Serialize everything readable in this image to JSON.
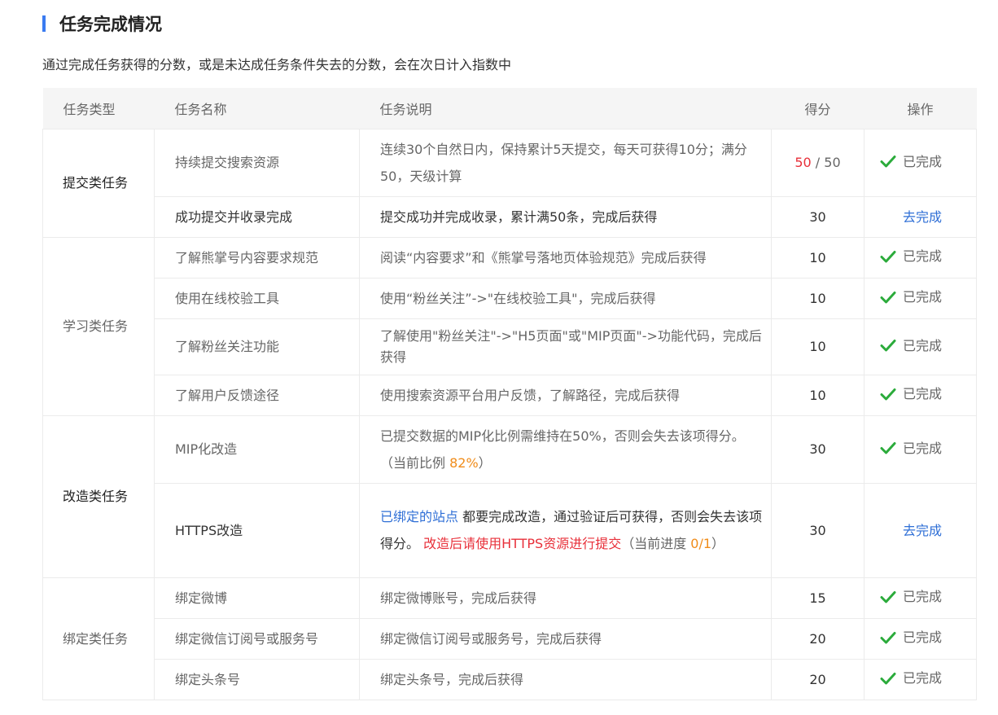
{
  "section": {
    "title": "任务完成情况",
    "description": "通过完成任务获得的分数，或是未达成任务条件失去的分数，会在次日计入指数中"
  },
  "table": {
    "headers": {
      "type": "任务类型",
      "name": "任务名称",
      "explanation": "任务说明",
      "score": "得分",
      "action": "操作"
    },
    "status": {
      "done": "已完成",
      "todo": "去完成"
    },
    "categories": {
      "submit": "提交类任务",
      "learn": "学习类任务",
      "modify": "改造类任务",
      "bind": "绑定类任务"
    },
    "rows": {
      "r1": {
        "name": "持续提交搜索资源",
        "explanation": "连续30个自然日内，保持累计5天提交，每天可获得10分；满分50，天级计算",
        "score": "50",
        "score_sep": " / ",
        "score_max": "50"
      },
      "r2": {
        "name": "成功提交并收录完成",
        "explanation": "提交成功并完成收录，累计满50条，完成后获得",
        "score": "30"
      },
      "r3": {
        "name": "了解熊掌号内容要求规范",
        "explanation": "阅读“内容要求”和《熊掌号落地页体验规范》完成后获得",
        "score": "10"
      },
      "r4": {
        "name": "使用在线校验工具",
        "explanation": "使用“粉丝关注”->\"在线校验工具\"，完成后获得",
        "score": "10"
      },
      "r5": {
        "name": "了解粉丝关注功能",
        "explanation": "了解使用\"粉丝关注\"->\"H5页面\"或\"MIP页面\"->功能代码，完成后获得",
        "score": "10"
      },
      "r6": {
        "name": "了解用户反馈途径",
        "explanation": "使用搜索资源平台用户反馈，了解路径，完成后获得",
        "score": "10"
      },
      "r7": {
        "name": "MIP化改造",
        "explanation_pre": "已提交数据的MIP化比例需维持在50%，否则会失去该项得分。 （当前比例 ",
        "explanation_ratio": "82%",
        "explanation_post": "）",
        "score": "30"
      },
      "r8": {
        "name": "HTTPS改造",
        "explanation_link": "已绑定的站点",
        "explanation_mid": " 都要完成改造，通过验证后可获得，否则会失去该项得分。 ",
        "explanation_warn": "改造后请使用HTTPS资源进行提交",
        "explanation_progress_pre": "（当前进度 ",
        "explanation_progress": "0/1",
        "explanation_progress_post": "）",
        "score": "30"
      },
      "r9": {
        "name": "绑定微博",
        "explanation": "绑定微博账号，完成后获得",
        "score": "15"
      },
      "r10": {
        "name": "绑定微信订阅号或服务号",
        "explanation": "绑定微信订阅号或服务号，完成后获得",
        "score": "20"
      },
      "r11": {
        "name": "绑定头条号",
        "explanation": "绑定头条号，完成后获得",
        "score": "20"
      }
    }
  },
  "colors": {
    "accent": "#3a7bf1",
    "score_red": "#e8303a",
    "highlight_orange": "#f08c1a",
    "link_blue": "#2f6fd6",
    "check_green": "#2bab3b"
  },
  "icons": {
    "done": "check-icon"
  }
}
